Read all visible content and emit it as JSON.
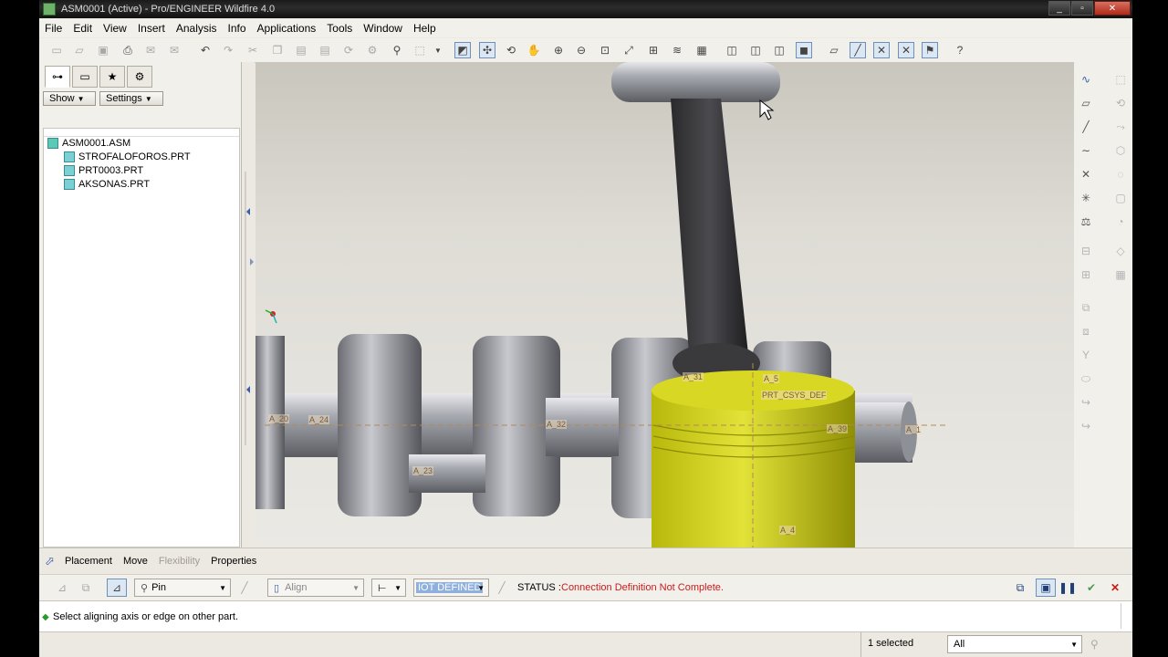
{
  "window": {
    "title": "ASM0001 (Active) - Pro/ENGINEER Wildfire 4.0",
    "buttons": [
      "_",
      "▫",
      "✕"
    ]
  },
  "menubar": {
    "items": [
      "File",
      "Edit",
      "View",
      "Insert",
      "Analysis",
      "Info",
      "Applications",
      "Tools",
      "Window",
      "Help"
    ]
  },
  "sidebar": {
    "show_label": "Show",
    "settings_label": "Settings",
    "tree": {
      "root": "ASM0001.ASM",
      "children": [
        "STROFALOFOROS.PRT",
        "PRT0003.PRT",
        "AKSONAS.PRT"
      ]
    }
  },
  "viewport": {
    "annotations": [
      "A_20",
      "A_24",
      "A_23",
      "A_32",
      "A_31",
      "A_5",
      "PRT_CSYS_DEF",
      "A_39",
      "A_1",
      "A_4"
    ]
  },
  "dashboard": {
    "tabs": [
      "Placement",
      "Move",
      "Flexibility",
      "Properties"
    ],
    "connection_type": "Pin",
    "constraint_type": "Align",
    "not_defined_label": "IOT DEFINED",
    "status_label": "STATUS :",
    "status_message": "Connection Definition Not Complete.",
    "colors": {
      "status_error": "#cc1a1a",
      "piston": "#cfcf16",
      "highlight": "#8fb0dc"
    }
  },
  "message": {
    "text": "Select aligning axis or edge on other part."
  },
  "statusbar": {
    "selected_count": "1 selected",
    "filter_value": "All"
  }
}
